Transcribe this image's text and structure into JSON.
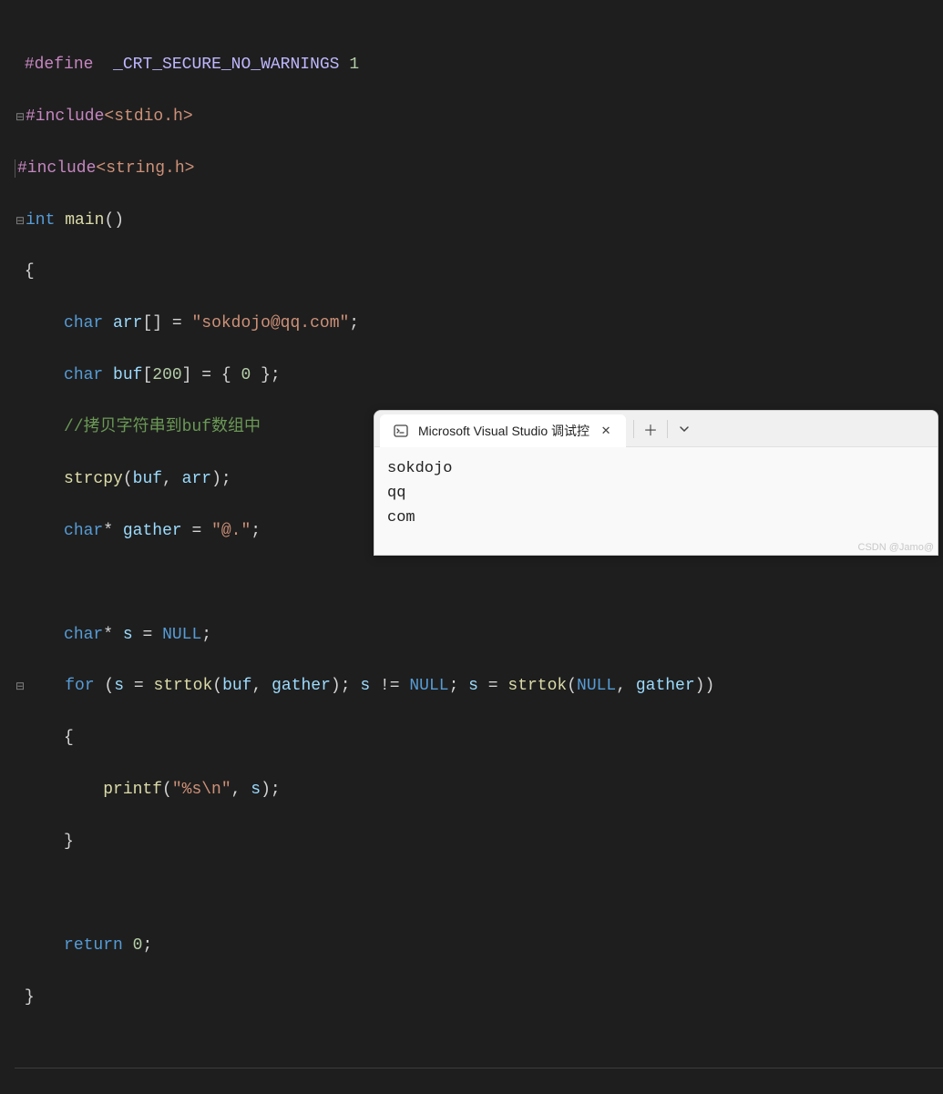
{
  "code": {
    "l1_define": "#define",
    "l1_macro": "_CRT_SECURE_NO_WARNINGS",
    "l1_val": "1",
    "l2_inc": "#include",
    "l2_hdr": "<stdio.h>",
    "l3_inc": "#include",
    "l3_hdr": "<string.h>",
    "l4_kw": "int",
    "l4_fn": "main",
    "l4_p": "()",
    "l5": "{",
    "l6_kw": "char",
    "l6_var": "arr",
    "l6_br": "[]",
    "l6_eq": " = ",
    "l6_str": "\"sokdojo@qq.com\"",
    "l6_semi": ";",
    "l7_kw": "char",
    "l7_var": "buf",
    "l7_br": "[",
    "l7_num": "200",
    "l7_br2": "]",
    "l7_eq": " = { ",
    "l7_zero": "0",
    "l7_end": " };",
    "l8_cmt": "//拷贝字符串到buf数组中",
    "l9_fn": "strcpy",
    "l9_args_open": "(",
    "l9_a1": "buf",
    "l9_comma": ", ",
    "l9_a2": "arr",
    "l9_close": ");",
    "l10_kw": "char",
    "l10_star": "*",
    "l10_var": "gather",
    "l10_eq": " = ",
    "l10_str": "\"@.\"",
    "l10_semi": ";",
    "l12_kw": "char",
    "l12_star": "*",
    "l12_var": "s",
    "l12_eq": " = ",
    "l12_null": "NULL",
    "l12_semi": ";",
    "l13_for": "for",
    "l13_open": " (",
    "l13_s1": "s",
    "l13_eq1": " = ",
    "l13_fn1": "strtok",
    "l13_p1": "(",
    "l13_a1": "buf",
    "l13_c1": ", ",
    "l13_a2": "gather",
    "l13_p2": "); ",
    "l13_s2": "s",
    "l13_ne": " != ",
    "l13_null": "NULL",
    "l13_semi2": "; ",
    "l13_s3": "s",
    "l13_eq2": " = ",
    "l13_fn2": "strtok",
    "l13_p3": "(",
    "l13_null2": "NULL",
    "l13_c2": ", ",
    "l13_a3": "gather",
    "l13_p4": "))",
    "l14": "{",
    "l15_fn": "printf",
    "l15_open": "(",
    "l15_str": "\"%s\\n\"",
    "l15_c": ", ",
    "l15_a": "s",
    "l15_close": ");",
    "l16": "}",
    "l18_ret": "return",
    "l18_zero": "0",
    "l18_semi": ";",
    "l19": "}"
  },
  "terminal": {
    "tab_title": "Microsoft Visual Studio 调试控",
    "output": [
      "sokdojo",
      "qq",
      "com"
    ]
  },
  "watermark": "CSDN @Jamo@"
}
